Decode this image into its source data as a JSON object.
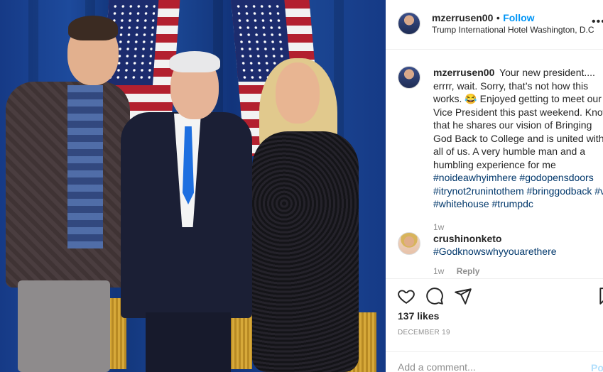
{
  "post": {
    "username": "mzerrusen00",
    "follow_label": "Follow",
    "separator": "•",
    "location": "Trump International Hotel Washington, D.C",
    "more_label": "•••",
    "photo_alt": "Three people posing in front of American flags"
  },
  "caption": {
    "username": "mzerrusen00",
    "text": "Your new president.... errrr, wait. Sorry, that’s not how this works. 😂 Enjoyed getting to meet our Vice President this past weekend. Know that he shares our vision of Bringing God Back to College and is united with all of us. A very humble man and a humbling experience for me",
    "hashtags": "#noideawhyimhere #godopensdoors #itrynot2runintothem #bringgodback #vp #whitehouse #trumpdc",
    "age": "1w"
  },
  "comments": [
    {
      "username": "crushinonketo",
      "text": "#Godknowswhyyouarethere",
      "age": "1w",
      "reply_label": "Reply"
    }
  ],
  "actions": {
    "like_icon": "heart-icon",
    "comment_icon": "comment-icon",
    "share_icon": "share-icon",
    "save_icon": "bookmark-icon"
  },
  "likes": "137 likes",
  "date": "DECEMBER 19",
  "add_comment": {
    "placeholder": "Add a comment...",
    "post_label": "Post"
  },
  "colors": {
    "link_blue": "#0095f6",
    "hashtag_blue": "#00376b",
    "muted": "#8e8e8e",
    "post_disabled": "#b2dffc"
  }
}
